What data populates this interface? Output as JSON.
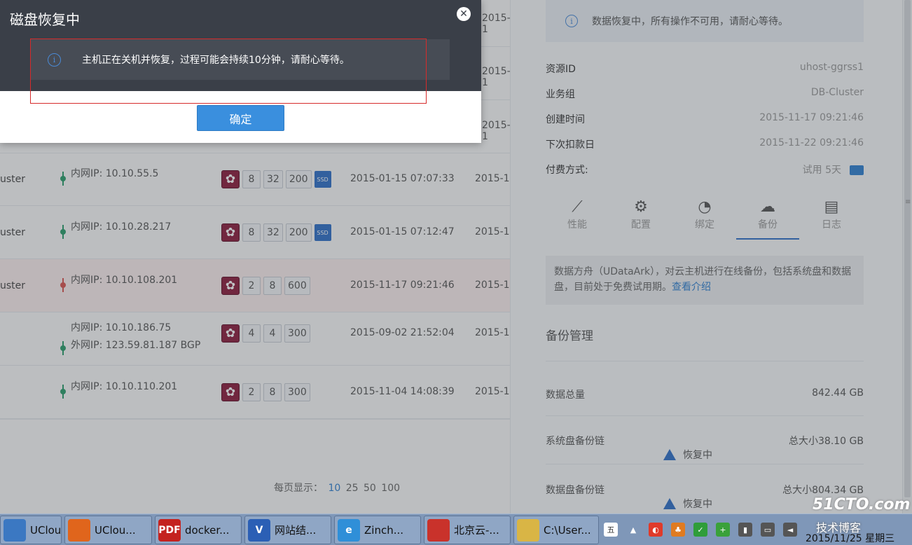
{
  "modal": {
    "title": "磁盘恢复中",
    "message": "主机正在关机并恢复，过程可能会持续10分钟，请耐心等待。",
    "ok_label": "确定"
  },
  "host_list": {
    "rows": [
      {
        "group": "uster",
        "ips": [
          "内网IP: 10.10.55.5"
        ],
        "cpu": "8",
        "mem": "32",
        "disk": "200",
        "ssd": "SSD",
        "created": "2015-01-15 07:07:33",
        "expire": "2015-1",
        "alert": false
      },
      {
        "group": "uster",
        "ips": [
          "内网IP: 10.10.28.217"
        ],
        "cpu": "8",
        "mem": "32",
        "disk": "200",
        "ssd": "SSD",
        "created": "2015-01-15 07:12:47",
        "expire": "2015-1",
        "alert": false
      },
      {
        "group": "uster",
        "ips": [
          "内网IP: 10.10.108.201"
        ],
        "cpu": "2",
        "mem": "8",
        "disk": "600",
        "ssd": "",
        "created": "2015-11-17 09:21:46",
        "expire": "2015-1",
        "alert": true
      },
      {
        "group": "",
        "ips": [
          "内网IP: 10.10.186.75",
          "外网IP: 123.59.81.187 BGP"
        ],
        "cpu": "4",
        "mem": "4",
        "disk": "300",
        "ssd": "",
        "created": "2015-09-02 21:52:04",
        "expire": "2015-1",
        "alert": false
      },
      {
        "group": "",
        "ips": [
          "内网IP: 10.10.110.201"
        ],
        "cpu": "2",
        "mem": "8",
        "disk": "300",
        "ssd": "",
        "created": "2015-11-04 14:08:39",
        "expire": "2015-1",
        "alert": false
      }
    ],
    "hidden_expire": [
      "2015-1",
      "2015-1",
      "2015-1"
    ],
    "pager": {
      "label": "每页显示：",
      "sizes": [
        "10",
        "25",
        "50",
        "100"
      ],
      "current": "10"
    }
  },
  "panel": {
    "notice": "数据恢复中，所有操作不可用，请耐心等待。",
    "fields": [
      {
        "k": "资源ID",
        "v": "uhost-ggrss1"
      },
      {
        "k": "业务组",
        "v": "DB-Cluster"
      },
      {
        "k": "创建时间",
        "v": "2015-11-17 09:21:46"
      },
      {
        "k": "下次扣款日",
        "v": "2015-11-22 09:21:46"
      },
      {
        "k": "付费方式:",
        "v": "试用 5天"
      }
    ],
    "tabs": [
      {
        "label": "性能",
        "icon": "chart-line-icon",
        "glyph": "⟋"
      },
      {
        "label": "配置",
        "icon": "gear-icon",
        "glyph": "⚙"
      },
      {
        "label": "绑定",
        "icon": "bind-icon",
        "glyph": "◔"
      },
      {
        "label": "备份",
        "icon": "cloud-backup-icon",
        "glyph": "☁"
      },
      {
        "label": "日志",
        "icon": "log-icon",
        "glyph": "▤"
      }
    ],
    "ark_text": "数据方舟（UDataArk），对云主机进行在线备份，包括系统盘和数据盘，目前处于免费试用期。",
    "ark_link": "查看介绍",
    "backup_title": "备份管理",
    "total_label": "数据总量",
    "total_value": "842.44 GB",
    "chains": [
      {
        "label": "系统盘备份链",
        "status": "恢复中",
        "size": "总大小38.10 GB"
      },
      {
        "label": "数据盘备份链",
        "status": "恢复中",
        "size": "总大小804.34 GB"
      }
    ]
  },
  "taskbar": {
    "items": [
      {
        "label": "UClou...",
        "color": "#3b78c2",
        "glyph": ""
      },
      {
        "label": "UClou...",
        "color": "#e0651c",
        "glyph": ""
      },
      {
        "label": "docker...",
        "color": "#c4221f",
        "glyph": "PDF"
      },
      {
        "label": "网站结...",
        "color": "#2b5fb5",
        "glyph": "V"
      },
      {
        "label": "Zinch...",
        "color": "#2f8fd8",
        "glyph": "e"
      },
      {
        "label": "北京云-...",
        "color": "#c9322b",
        "glyph": ""
      },
      {
        "label": "C:\\User...",
        "color": "#d9b545",
        "glyph": ""
      }
    ],
    "clock_date": "2015/11/25 星期三",
    "watermark": "51CTO.com",
    "watermark_sub": "技术博客"
  }
}
